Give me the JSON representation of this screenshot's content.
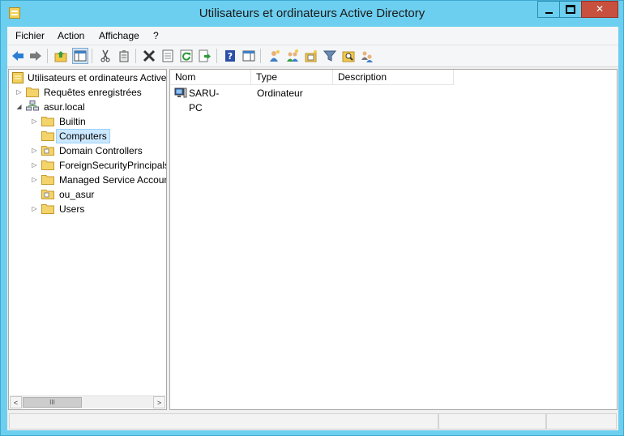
{
  "window": {
    "title": "Utilisateurs et ordinateurs Active Directory",
    "controls": {
      "minimize": "minimize-icon",
      "maximize": "maximize-icon",
      "close": "✕"
    }
  },
  "menu": [
    "Fichier",
    "Action",
    "Affichage",
    "?"
  ],
  "toolbar": [
    "back-arrow-icon",
    "forward-arrow-icon",
    "up-folder-icon",
    "console-tree-icon",
    "cut-icon",
    "paste-icon",
    "delete-icon",
    "properties-icon",
    "refresh-icon",
    "export-list-icon",
    "help-icon",
    "action-pane-icon",
    "new-user-icon",
    "new-group-icon",
    "new-ou-icon",
    "filter-icon",
    "find-icon",
    "add-to-group-icon"
  ],
  "tree": {
    "root": "Utilisateurs et ordinateurs Active Directory",
    "items": [
      {
        "label": "Requêtes enregistrées",
        "expander": "▷"
      },
      {
        "label": "asur.local",
        "expander": "◢"
      },
      {
        "label": "Builtin",
        "expander": "▷"
      },
      {
        "label": "Computers",
        "expander": "",
        "selected": true
      },
      {
        "label": "Domain Controllers",
        "expander": "▷"
      },
      {
        "label": "ForeignSecurityPrincipals",
        "expander": "▷"
      },
      {
        "label": "Managed Service Accounts",
        "expander": "▷"
      },
      {
        "label": "ou_asur",
        "expander": ""
      },
      {
        "label": "Users",
        "expander": "▷"
      }
    ],
    "scrollbar": {
      "left": "<",
      "thumb": "III",
      "right": ">"
    }
  },
  "list": {
    "columns": [
      "Nom",
      "Type",
      "Description"
    ],
    "rows": [
      {
        "name": "SARU-PC",
        "type": "Ordinateur",
        "description": ""
      }
    ]
  },
  "colors": {
    "titlebar": "#6dcff0",
    "close": "#c7503e",
    "selection": "#cce8ff"
  }
}
